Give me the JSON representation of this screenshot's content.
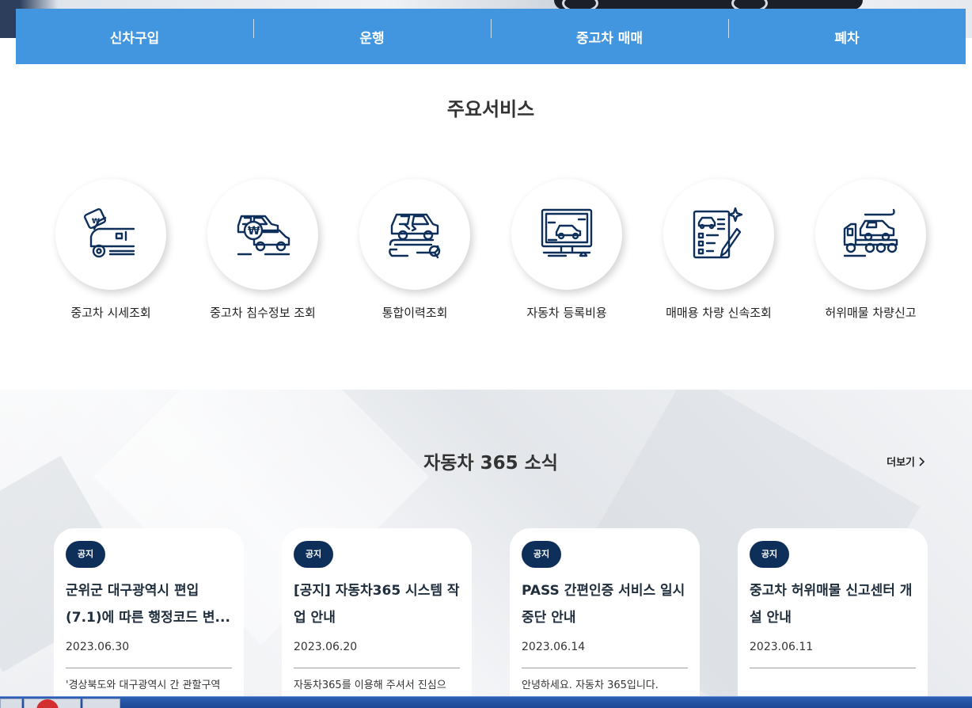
{
  "nav": {
    "items": [
      "신차구입",
      "운행",
      "중고차 매매",
      "폐차"
    ]
  },
  "services": {
    "title": "주요서비스",
    "items": [
      {
        "label": "중고차 시세조회",
        "icon": "car-price-tag-icon"
      },
      {
        "label": "중고차 침수정보 조회",
        "icon": "flooded-car-search-icon"
      },
      {
        "label": "통합이력조회",
        "icon": "car-repair-history-icon"
      },
      {
        "label": "자동차 등록비용",
        "icon": "monitor-car-icon"
      },
      {
        "label": "매매용 차량 신속조회",
        "icon": "document-checklist-icon"
      },
      {
        "label": "허위매물 차량신고",
        "icon": "tow-truck-icon"
      }
    ]
  },
  "news": {
    "title": "자동차 365 소식",
    "more_label": "더보기",
    "cards": [
      {
        "badge": "공지",
        "title": "군위군 대구광역시 편입 (7.1)에 따른 행정코드 변...",
        "date": "2023.06.30",
        "summary": "'경상북도와 대구광역시 간 관할구역"
      },
      {
        "badge": "공지",
        "title": "[공지] 자동차365 시스템 작업 안내",
        "date": "2023.06.20",
        "summary": "자동차365를 이용해 주셔서 진심으"
      },
      {
        "badge": "공지",
        "title": "PASS 간편인증 서비스 일시 중단 안내",
        "date": "2023.06.14",
        "summary": "안녕하세요. 자동차 365입니다."
      },
      {
        "badge": "공지",
        "title": "중고차 허위매물 신고센터 개설 안내",
        "date": "2023.06.11",
        "summary": ""
      }
    ]
  },
  "colors": {
    "nav_bg": "#4196df",
    "badge_bg": "#0d2f5a",
    "icon_stroke": "#0d2f5a"
  }
}
